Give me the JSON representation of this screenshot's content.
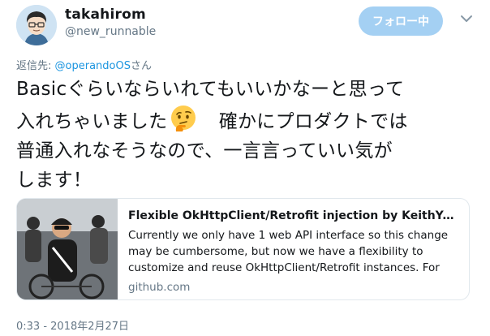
{
  "user": {
    "display_name": "takahirom",
    "handle": "@new_runnable"
  },
  "follow_button_label": "フォロー中",
  "reply_to": {
    "prefix": "返信先: ",
    "mention": "@operandoOS",
    "suffix": "さん"
  },
  "tweet": {
    "line1": "Basicぐらいならいれてもいいかなーと思って",
    "line2a": "入れちゃいました",
    "line2b": "　確かにプロダクトでは",
    "line3": "普通入れなそうなので、一言言っていい気が",
    "line4": "します！"
  },
  "card": {
    "title": "Flexible OkHttpClient/Retrofit injection by KeithYokoma · P…",
    "description": "Currently we only have 1 web API interface so this change may be cumbersome, but now we have a flexibility to customize and reuse OkHttpClient/Retrofit instances. For OkHttpClient, each…",
    "domain": "github.com"
  },
  "timestamp": "0:33 - 2018年2月27日",
  "icons": {
    "emoji": "thinking-face-emoji",
    "menu": "chevron-down-icon"
  },
  "colors": {
    "link": "#1b95e0",
    "follow_button": "#a4d0f3",
    "muted": "#657786"
  }
}
